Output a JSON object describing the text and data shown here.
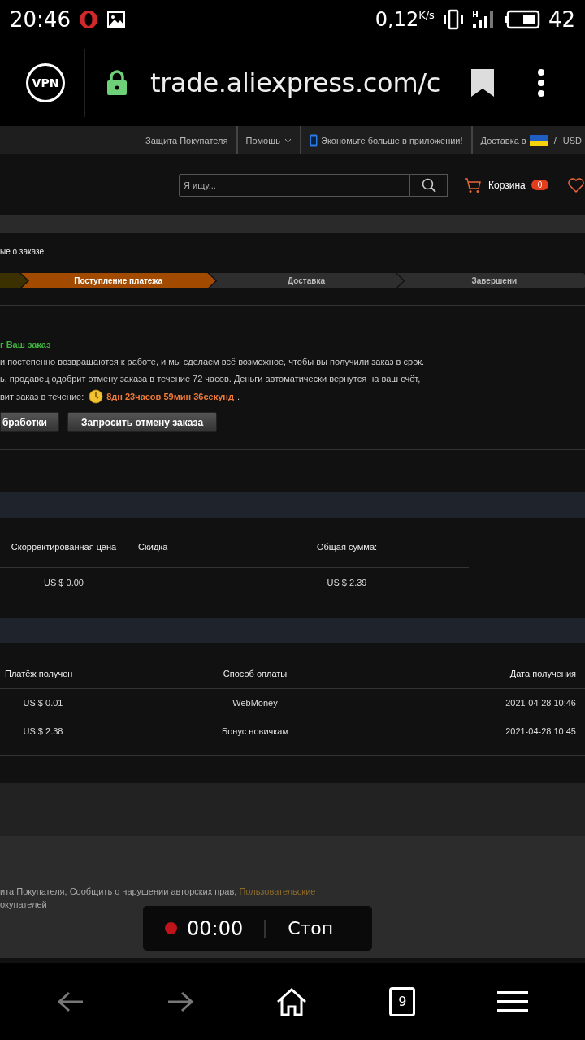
{
  "status_bar": {
    "time": "20:46",
    "speed": "0,12",
    "speed_unit": "K/s",
    "battery": "42"
  },
  "browser": {
    "url": "trade.aliexpress.com/c",
    "vpn_label": "VPN",
    "tab_count": "9"
  },
  "site_top": {
    "items": [
      {
        "kind": "link",
        "label": "Защита Покупателя"
      },
      {
        "kind": "dropdown",
        "label": "Помощь"
      },
      {
        "kind": "app",
        "label": "Экономьте больше в приложении!"
      },
      {
        "kind": "ship",
        "label": "Доставка в",
        "separator": "/",
        "currency": "USD"
      }
    ]
  },
  "header": {
    "search_placeholder": "Я ищу...",
    "cart_label": "Корзина",
    "cart_count": "0"
  },
  "order": {
    "section_title": "ые о заказе",
    "steps": [
      {
        "done": true,
        "selected": false
      },
      {
        "label": "Поступление платежа",
        "done": false,
        "selected": true
      },
      {
        "label": "Доставка",
        "done": false,
        "selected": false
      },
      {
        "label": "Завершени",
        "done": false,
        "selected": false
      }
    ],
    "notice_title": "г Ваш заказ",
    "lines": [
      "и постепенно возвращаются к работе, и мы сделаем всё возможное, чтобы вы получили заказ в срок.",
      "ь, продавец одобрит отмену заказа в течение 72 часов. Деньги автоматически вернутся на ваш счёт,"
    ],
    "countdown_label": "вит заказ в течение:",
    "countdown": "8дн 23часов 59мин 36секунд",
    "countdown_end": ".",
    "buttons": [
      "бработки",
      "Запросить отмену заказа"
    ]
  },
  "price_table": {
    "columns": [
      "Скорректированная цена",
      "Скидка",
      "Общая сумма:"
    ],
    "rows": [
      {
        "adjusted_price": "US $ 0.00",
        "total": "US $ 2.39"
      }
    ]
  },
  "payment_table": {
    "columns": [
      "Платёж получен",
      "Способ оплаты",
      "Дата получения"
    ],
    "rows": [
      [
        "US $ 0.01",
        "WebMoney",
        "2021-04-28 10:46"
      ],
      [
        "US $ 2.38",
        "Бонус новичкам",
        "2021-04-28 10:45"
      ]
    ]
  },
  "footer": {
    "line_1": "ита Покупателя, Сообщить о нарушении авторских прав, ",
    "link": "Пользовательские",
    "line_2": "окупателей"
  },
  "recorder": {
    "time": "00:00",
    "stop_label": "Стоп",
    "recording": true
  }
}
